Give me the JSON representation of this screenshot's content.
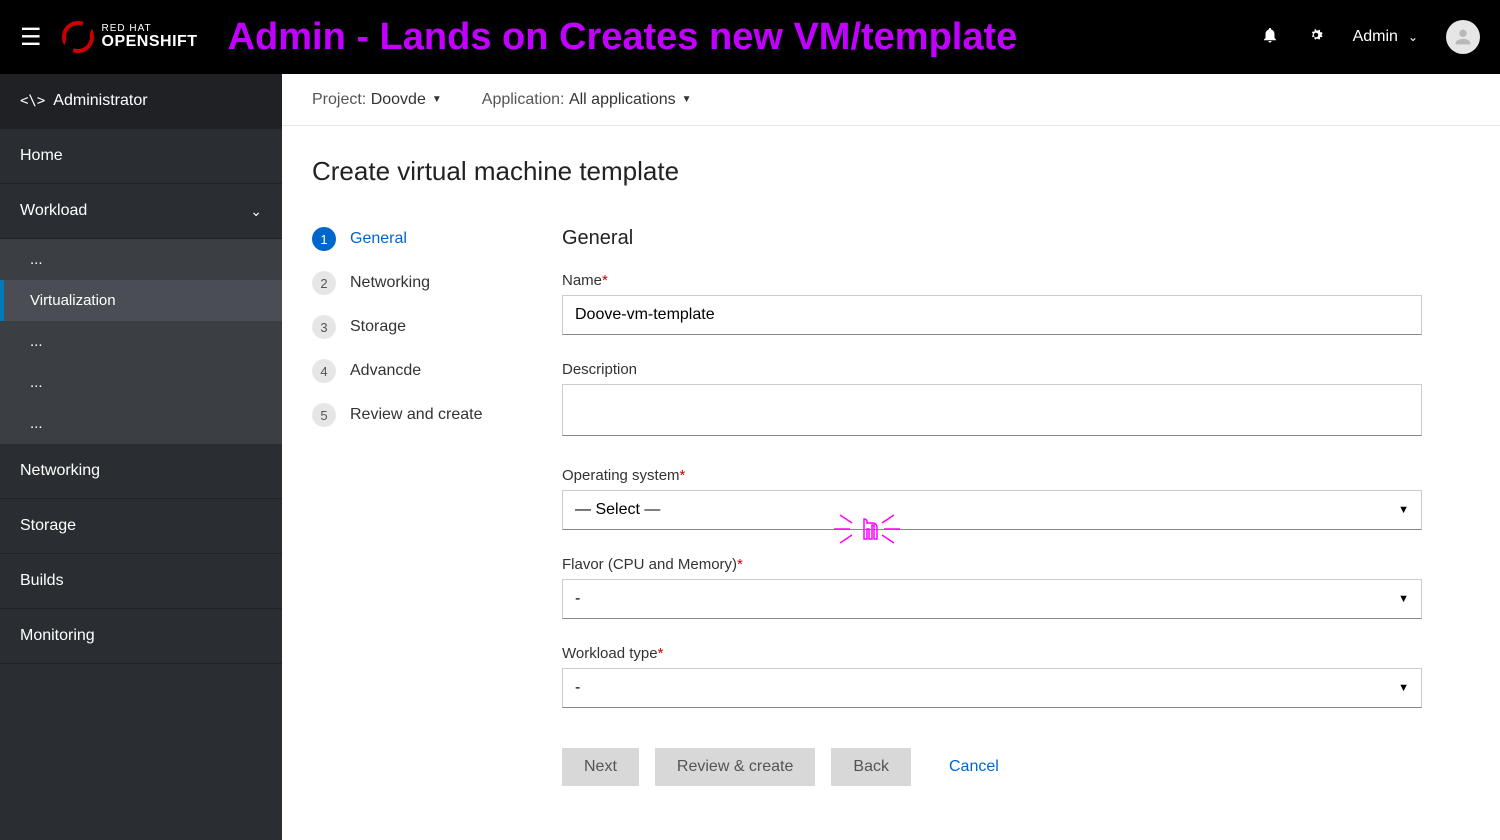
{
  "header": {
    "logo_top": "RED HAT",
    "logo_bottom": "OPENSHIFT",
    "page_title": "Admin - Lands on Creates new VM/template",
    "user_label": "Admin"
  },
  "sidebar": {
    "role_label": "Administrator",
    "items": {
      "home": "Home",
      "workload": "Workload",
      "sub0": "...",
      "virtualization": "Virtualization",
      "sub2": "...",
      "sub3": "...",
      "sub4": "...",
      "networking": "Networking",
      "storage": "Storage",
      "builds": "Builds",
      "monitoring": "Monitoring"
    }
  },
  "breadcrumb": {
    "project_label": "Project:",
    "project_value": "Doovde",
    "app_label": "Application:",
    "app_value": "All applications"
  },
  "main": {
    "title": "Create virtual machine template",
    "steps": [
      {
        "num": "1",
        "label": "General"
      },
      {
        "num": "2",
        "label": "Networking"
      },
      {
        "num": "3",
        "label": "Storage"
      },
      {
        "num": "4",
        "label": "Advancde"
      },
      {
        "num": "5",
        "label": "Review and create"
      }
    ],
    "form": {
      "heading": "General",
      "name_label": "Name",
      "name_value": "Doove-vm-template",
      "desc_label": "Description",
      "desc_value": "",
      "os_label": "Operating system",
      "os_value": "— Select —",
      "flavor_label": "Flavor (CPU and Memory)",
      "flavor_value": "-",
      "workload_label": "Workload type",
      "workload_value": "-"
    },
    "buttons": {
      "next": "Next",
      "review": "Review & create",
      "back": "Back",
      "cancel": "Cancel"
    }
  }
}
